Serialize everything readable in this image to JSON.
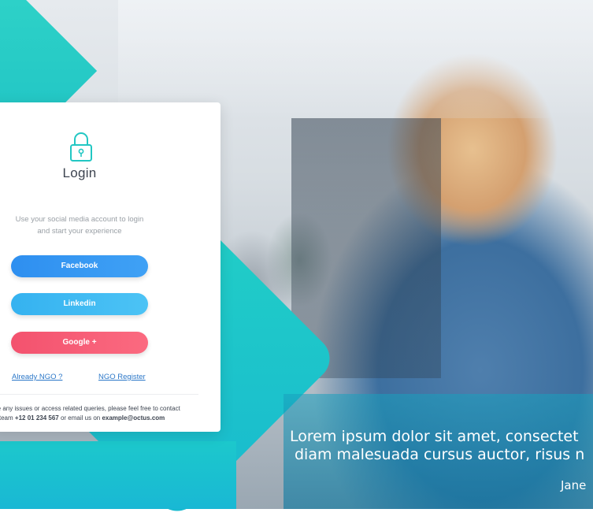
{
  "login": {
    "title": "Login",
    "subtitle_line1": "Use your social media account to login",
    "subtitle_line2": "and start your experience",
    "buttons": {
      "facebook": "Facebook",
      "linkedin": "Linkedin",
      "google": "Google +"
    },
    "links": {
      "already_ngo": "Already NGO ?",
      "ngo_register": "NGO Register"
    },
    "support": {
      "line1": "re any issues or access related queries, please feel free to contact",
      "line2_pre": "r team ",
      "phone": "+12 01 234 567",
      "line2_mid": " or email us on ",
      "email": "example@octus.com"
    }
  },
  "hero": {
    "quote_line1": "Lorem ipsum dolor sit amet, consectet",
    "quote_line2": "diam malesuada cursus auctor, risus n",
    "author": "Jane"
  },
  "colors": {
    "teal": "#22d0c6",
    "facebook": "#2e8ff0",
    "linkedin": "#35b2f0",
    "google": "#f3526e",
    "link": "#2b77c8"
  },
  "icons": {
    "lock": "lock-icon"
  }
}
